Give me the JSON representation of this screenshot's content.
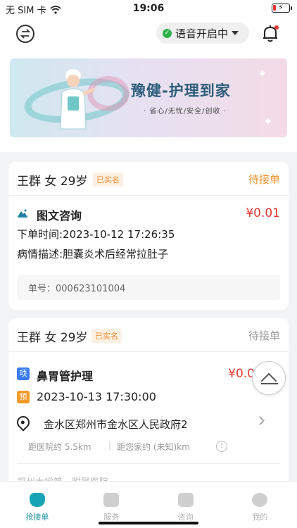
{
  "status_bar": {
    "carrier": "无 SIM 卡",
    "time": "19:06"
  },
  "header": {
    "voice_label": "语音开启中"
  },
  "banner": {
    "title": "豫健-护理到家",
    "subtitle": "· 省心/无忧/安全/创收 ·"
  },
  "orders": [
    {
      "name": "王群",
      "gender": "女",
      "age": "29岁",
      "verified": "已实名",
      "status": "待接单",
      "status_color": "#f0922b",
      "service": "图文咨询",
      "price": "¥0.01",
      "order_time": "下单时间:2023-10-12 17:26:35",
      "description": "病情描述:胆囊炎术后经常拉肚子",
      "order_no": "单号：000623101004"
    },
    {
      "name": "王群",
      "gender": "女",
      "age": "29岁",
      "verified": "已实名",
      "status": "待接单",
      "status_color": "#9a9a9a",
      "tag_item": "项",
      "service": "鼻胃管护理",
      "price": "¥0.0",
      "tag_appt": "预",
      "appointment": "2023-10-13 17:30:00",
      "address": "金水区郑州市金水区人民政府2",
      "dist_hospital": "距医院约 5.5km",
      "dist_home": "距您家约 (未知)km",
      "hospital": "郑州大学第一附属医院"
    }
  ],
  "tabbar": [
    {
      "label": "抢接单",
      "icon": "grab-order-icon"
    },
    {
      "label": "服务",
      "icon": "service-icon"
    },
    {
      "label": "咨询",
      "icon": "consult-icon"
    },
    {
      "label": "我的",
      "icon": "profile-icon"
    }
  ],
  "colors": {
    "accent": "#16a3b5",
    "price": "#e53935",
    "verified": "#f08a2a"
  }
}
